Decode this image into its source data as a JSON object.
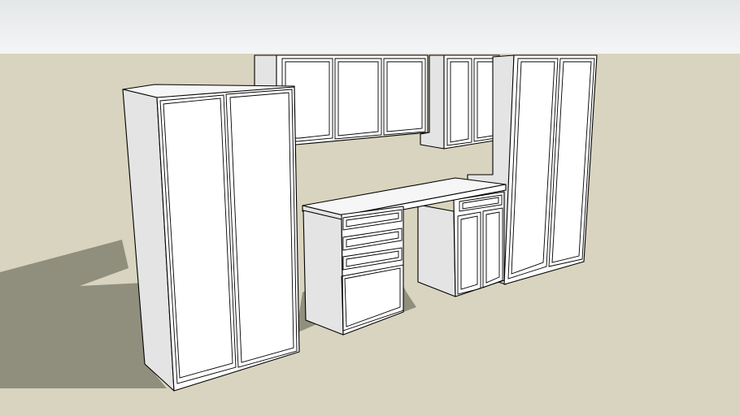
{
  "scene": {
    "colors": {
      "sky_top": "#e4e7e8",
      "sky_bottom": "#f4f5f6",
      "ground": "#d8d4bf",
      "shadow": "#908f7d",
      "cabinet_front": "#ffffff",
      "cabinet_side": "#e4e4e4",
      "cabinet_top": "#f6f6f6",
      "edge": "#000000"
    },
    "objects": [
      "tall-pantry-cabinet-left",
      "upper-wall-cabinets",
      "upper-corner-cabinet",
      "desk-countertop",
      "drawer-base-cabinet",
      "door-base-cabinet",
      "tall-pantry-cabinet-right"
    ]
  }
}
